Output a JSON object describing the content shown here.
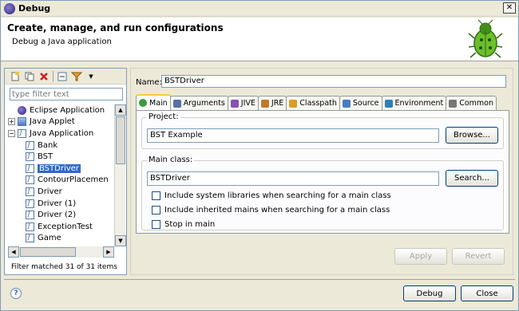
{
  "window": {
    "title": "Debug"
  },
  "banner": {
    "heading": "Create, manage, and run configurations",
    "subheading": "Debug a Java application"
  },
  "left": {
    "filter_placeholder": "type filter text",
    "status": "Filter matched 31 of 31 items",
    "tree": [
      {
        "label": "Eclipse Application",
        "level": 0,
        "icon": "eclipse-icon",
        "expander": ""
      },
      {
        "label": "Java Applet",
        "level": 0,
        "icon": "applet-icon",
        "expander": "+"
      },
      {
        "label": "Java Application",
        "level": 0,
        "icon": "java-app-icon",
        "expander": "−"
      },
      {
        "label": "Bank",
        "level": 1,
        "icon": "java-app-icon",
        "expander": ""
      },
      {
        "label": "BST",
        "level": 1,
        "icon": "java-app-icon",
        "expander": ""
      },
      {
        "label": "BSTDriver",
        "level": 1,
        "icon": "java-app-icon",
        "expander": "",
        "selected": true
      },
      {
        "label": "ContourPlacemen",
        "level": 1,
        "icon": "java-app-icon",
        "expander": ""
      },
      {
        "label": "Driver",
        "level": 1,
        "icon": "java-app-icon",
        "expander": ""
      },
      {
        "label": "Driver (1)",
        "level": 1,
        "icon": "java-app-icon",
        "expander": ""
      },
      {
        "label": "Driver (2)",
        "level": 1,
        "icon": "java-app-icon",
        "expander": ""
      },
      {
        "label": "ExceptionTest",
        "level": 1,
        "icon": "java-app-icon",
        "expander": ""
      },
      {
        "label": "Game",
        "level": 1,
        "icon": "java-app-icon",
        "expander": ""
      }
    ]
  },
  "config": {
    "name_label": "Name:",
    "name_value": "BSTDriver",
    "tabs": [
      {
        "label": "Main",
        "icon": "main-tab-icon",
        "active": true
      },
      {
        "label": "Arguments",
        "icon": "arguments-tab-icon"
      },
      {
        "label": "JIVE",
        "icon": "jive-tab-icon"
      },
      {
        "label": "JRE",
        "icon": "jre-tab-icon"
      },
      {
        "label": "Classpath",
        "icon": "classpath-tab-icon"
      },
      {
        "label": "Source",
        "icon": "source-tab-icon"
      },
      {
        "label": "Environment",
        "icon": "environment-tab-icon"
      },
      {
        "label": "Common",
        "icon": "common-tab-icon"
      }
    ],
    "project": {
      "title": "Project:",
      "value": "BST Example",
      "browse_label": "Browse..."
    },
    "main_class": {
      "title": "Main class:",
      "value": "BSTDriver",
      "search_label": "Search..."
    },
    "checkboxes": [
      {
        "label": "Include system libraries when searching for a main class",
        "checked": false
      },
      {
        "label": "Include inherited mains when searching for a main class",
        "checked": false
      },
      {
        "label": "Stop in main",
        "checked": false
      }
    ],
    "apply_label": "Apply",
    "revert_label": "Revert"
  },
  "footer": {
    "debug_label": "Debug",
    "close_label": "Close",
    "help_glyph": "?"
  }
}
